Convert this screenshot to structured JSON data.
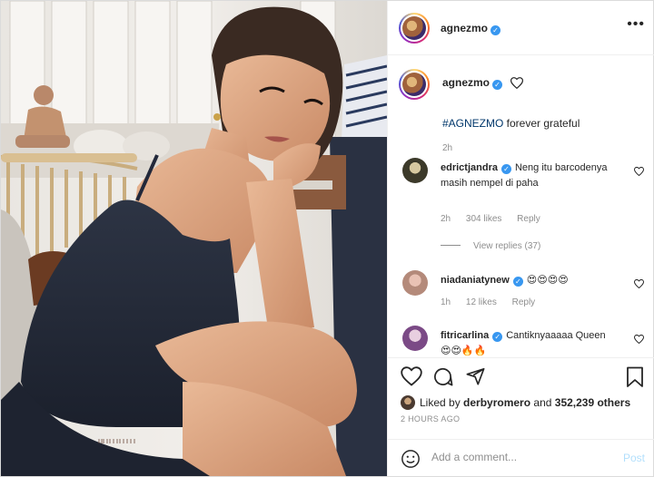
{
  "post": {
    "author": "agnezmo",
    "verified": true
  },
  "caption": {
    "username": "agnezmo",
    "hashtag": "#AGNEZMO",
    "text": " forever grateful",
    "time": "2h"
  },
  "comments": [
    {
      "username": "edrictjandra",
      "verified": true,
      "text": "Neng itu barcodenya masih nempel di paha",
      "time": "2h",
      "likes": "304 likes",
      "reply": "Reply"
    },
    {
      "username": "niadaniatynew",
      "verified": true,
      "text": "😍😍😍😍",
      "time": "1h",
      "likes": "12 likes",
      "reply": "Reply"
    },
    {
      "username": "fitricarlina",
      "verified": true,
      "text": "Cantiknyaaaaa Queen 😍😍🔥🔥"
    }
  ],
  "view_replies": "View replies (37)",
  "likes": {
    "prefix": "Liked by ",
    "liker": "derbyromero",
    "middle": " and ",
    "others": "352,239 others"
  },
  "time_ago": "2 HOURS AGO",
  "add_comment": {
    "placeholder": "Add a comment...",
    "post_label": "Post"
  },
  "icons": {
    "like": "heart-icon",
    "comment": "comment-icon",
    "share": "paper-plane-icon",
    "save": "bookmark-icon",
    "more": "more-options-icon",
    "emoji": "smiley-icon"
  },
  "colors": {
    "verified": "#3897f0",
    "hashtag": "#00376b",
    "muted": "#8e8e8e",
    "post_disabled": "#b2dffc"
  }
}
